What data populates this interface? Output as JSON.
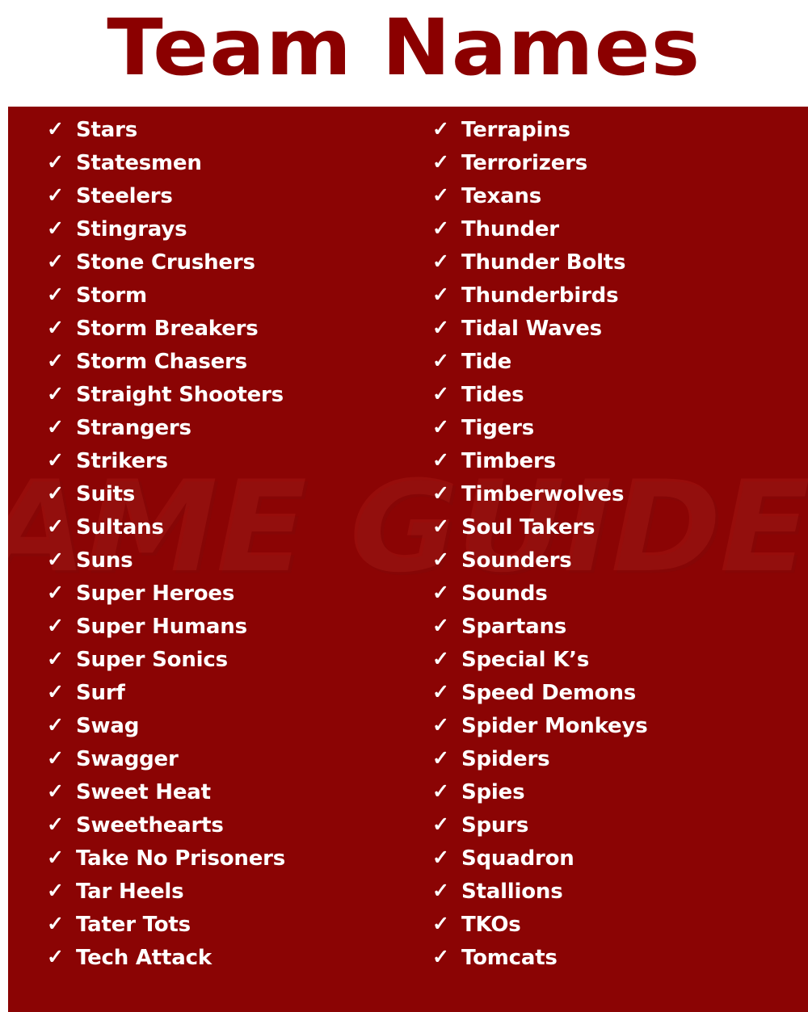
{
  "header": {
    "title": "Team Names"
  },
  "theme": {
    "page_background": "#ffffff",
    "panel_background": "#8B0404",
    "title_color": "#8B0000",
    "item_text_color": "#ffffff"
  },
  "watermark": {
    "text": "GAME GUIDER",
    "mark": "®"
  },
  "icons": {
    "check": "✓"
  },
  "columns": [
    {
      "name": "left-column",
      "items": [
        "Stars",
        "Statesmen",
        "Steelers",
        "Stingrays",
        "Stone Crushers",
        "Storm",
        "Storm Breakers",
        "Storm Chasers",
        "Straight Shooters",
        "Strangers",
        "Strikers",
        "Suits",
        "Sultans",
        "Suns",
        "Super Heroes",
        "Super Humans",
        "Super Sonics",
        "Surf",
        "Swag",
        "Swagger",
        "Sweet Heat",
        "Sweethearts",
        "Take No Prisoners",
        "Tar Heels",
        "Tater Tots",
        "Tech Attack"
      ]
    },
    {
      "name": "right-column",
      "items": [
        "Terrapins",
        "Terrorizers",
        "Texans",
        "Thunder",
        "Thunder Bolts",
        "Thunderbirds",
        "Tidal Waves",
        "Tide",
        "Tides",
        "Tigers",
        "Timbers",
        "Timberwolves",
        "Soul Takers",
        "Sounders",
        "Sounds",
        "Spartans",
        "Special K’s",
        "Speed Demons",
        "Spider Monkeys",
        "Spiders",
        "Spies",
        "Spurs",
        "Squadron",
        "Stallions",
        "TKOs",
        "Tomcats"
      ]
    }
  ]
}
